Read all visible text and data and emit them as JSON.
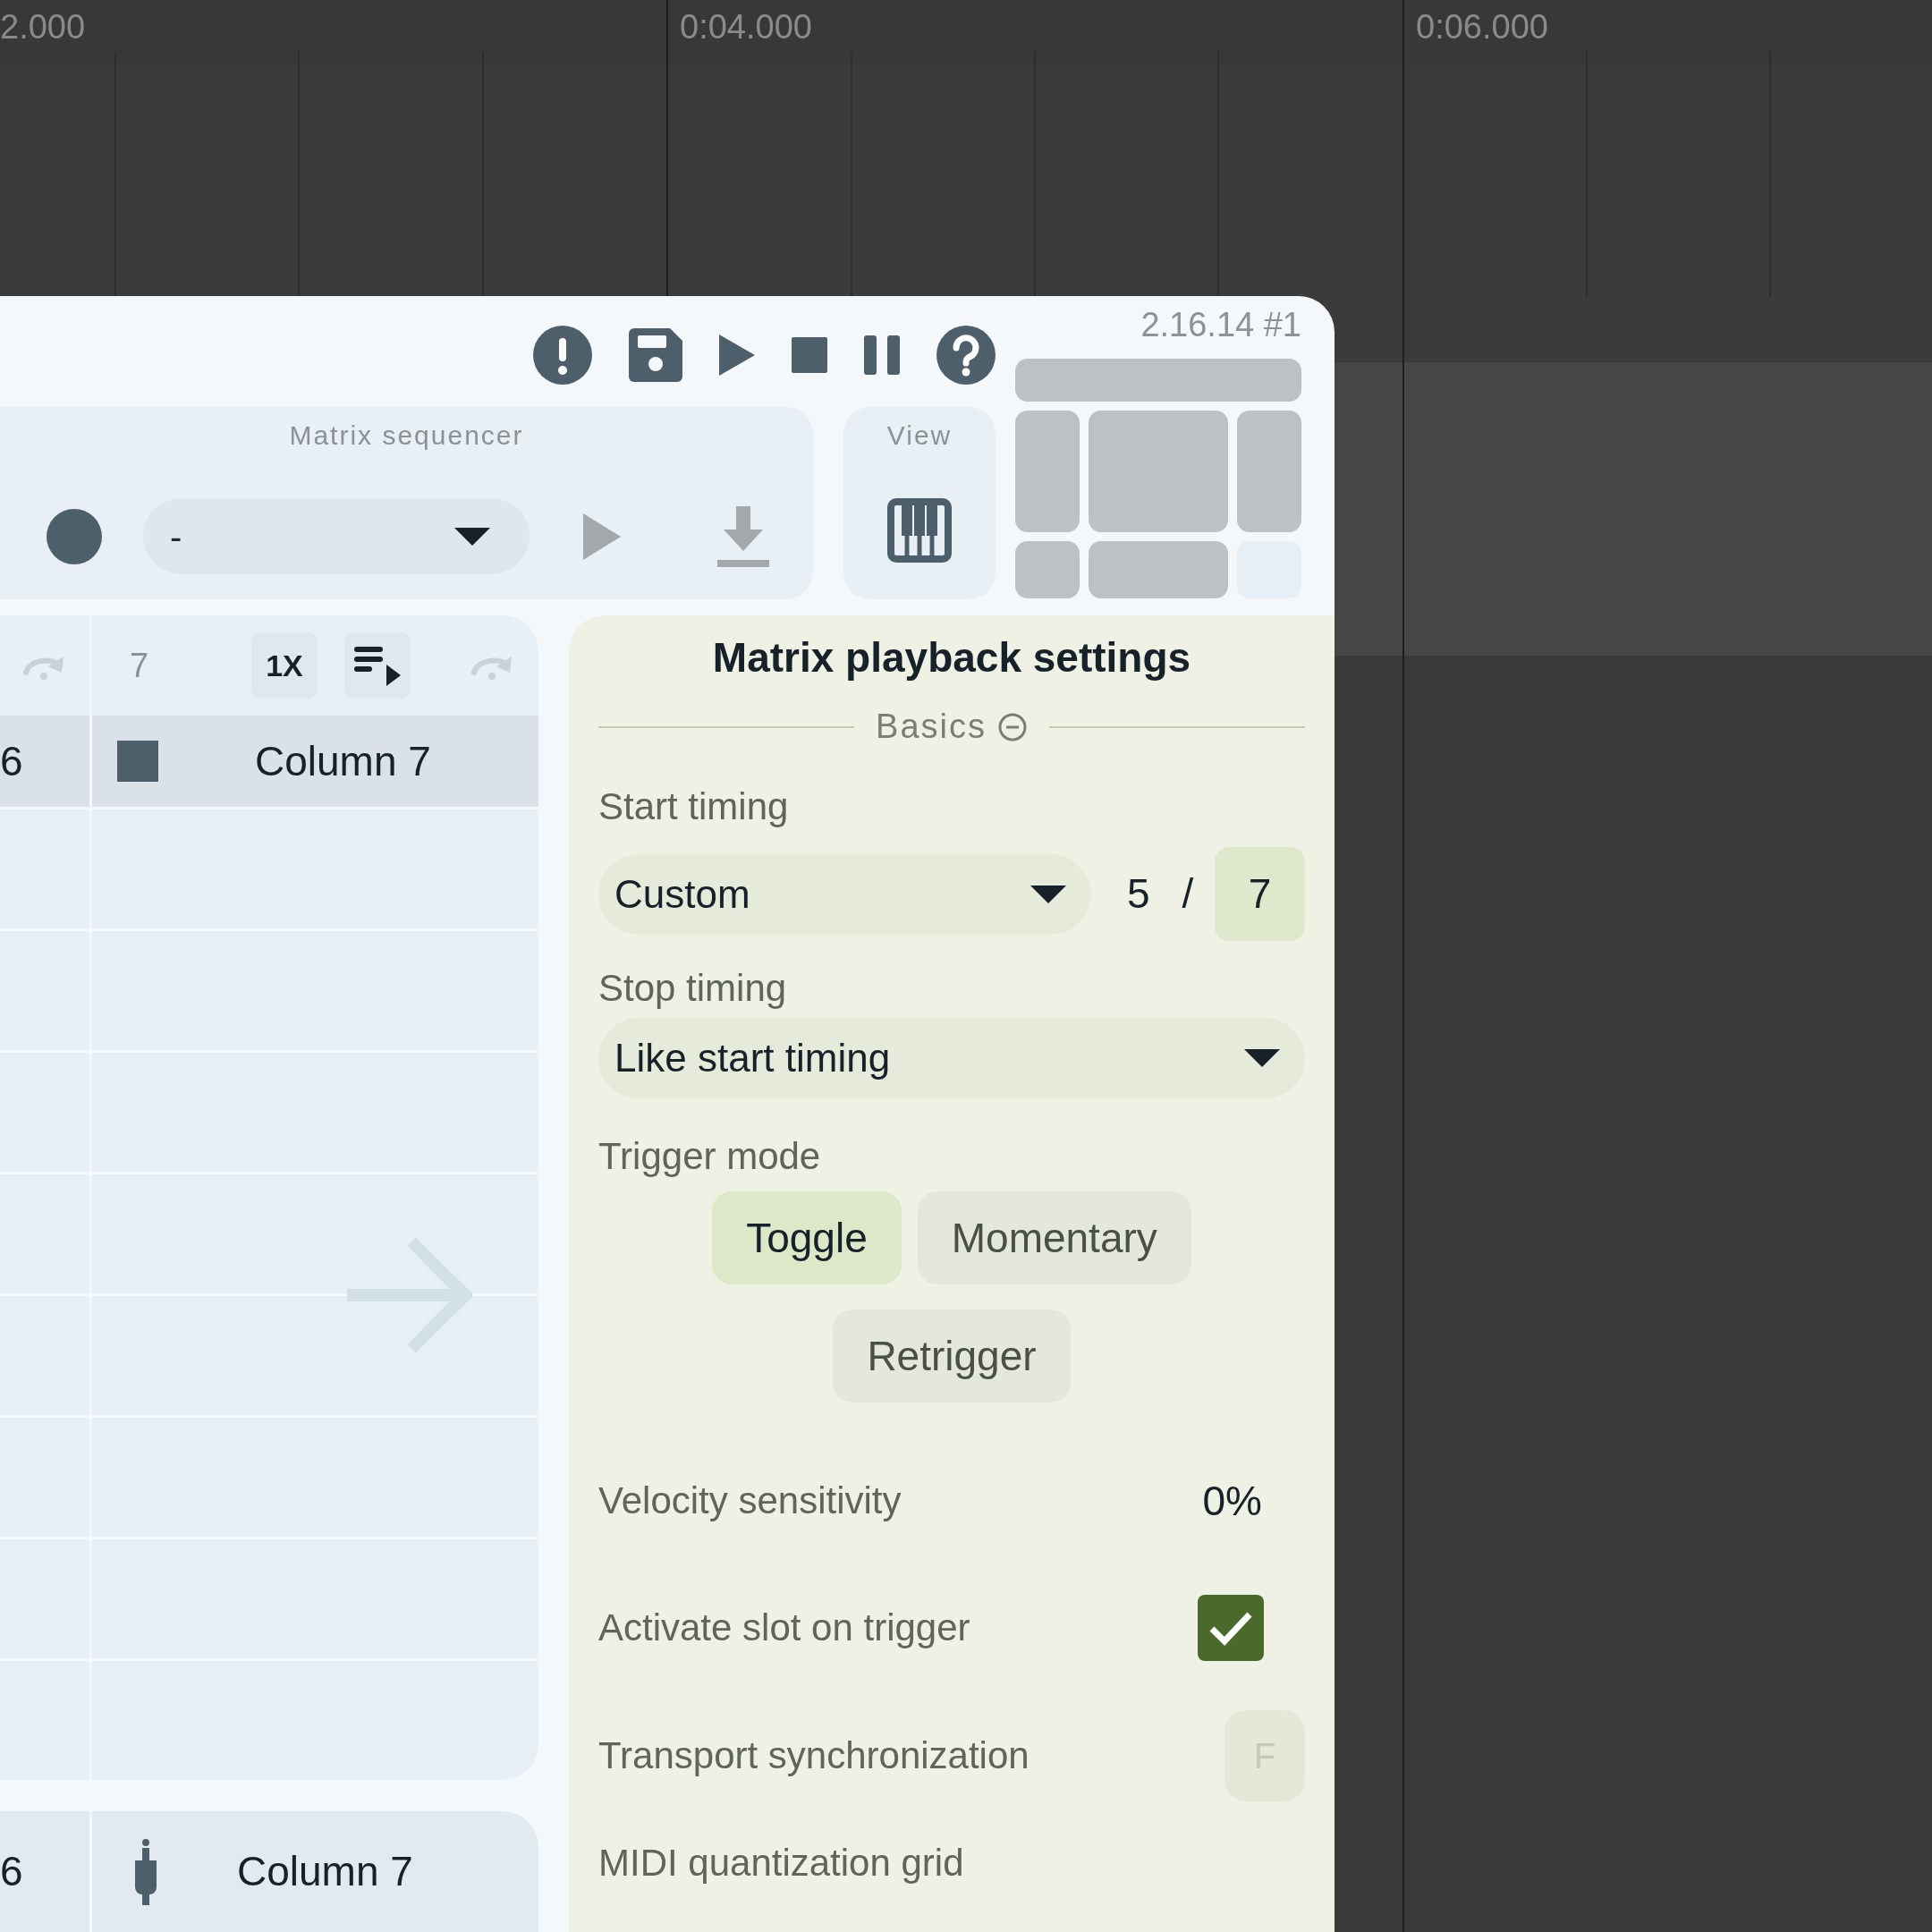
{
  "timeline": {
    "ruler_labels": [
      "2.000",
      "0:04.000",
      "0:06.000"
    ]
  },
  "toolbar": {
    "version": "2.16.14 #1"
  },
  "layout_preview": {
    "panes": [
      {
        "visible": true
      },
      {
        "visible": true
      },
      {
        "visible": true
      },
      {
        "visible": true
      },
      {
        "visible": true
      },
      {
        "visible": true
      },
      {
        "visible": false
      }
    ]
  },
  "sequencer": {
    "title": "Matrix sequencer",
    "selection": "-"
  },
  "view": {
    "title": "View"
  },
  "matrix": {
    "columns": [
      {
        "header": "6",
        "footer": "6"
      },
      {
        "number": "7",
        "speed": "1X",
        "header": "Column 7",
        "footer": "Column 7"
      }
    ]
  },
  "settings": {
    "title": "Matrix playback settings",
    "section": "Basics",
    "start_timing": {
      "label": "Start timing",
      "value": "Custom",
      "numerator": "5",
      "separator": "/",
      "denominator": "7"
    },
    "stop_timing": {
      "label": "Stop timing",
      "value": "Like start timing"
    },
    "trigger_mode": {
      "label": "Trigger mode",
      "options": [
        {
          "label": "Toggle",
          "selected": true
        },
        {
          "label": "Momentary",
          "selected": false
        },
        {
          "label": "Retrigger",
          "selected": false
        }
      ]
    },
    "velocity_sensitivity": {
      "label": "Velocity sensitivity",
      "value": "0%"
    },
    "activate_slot": {
      "label": "Activate slot on trigger",
      "checked": true
    },
    "transport_sync": {
      "label": "Transport synchronization",
      "value": "F"
    },
    "midi_grid": {
      "label": "MIDI quantization grid"
    }
  }
}
